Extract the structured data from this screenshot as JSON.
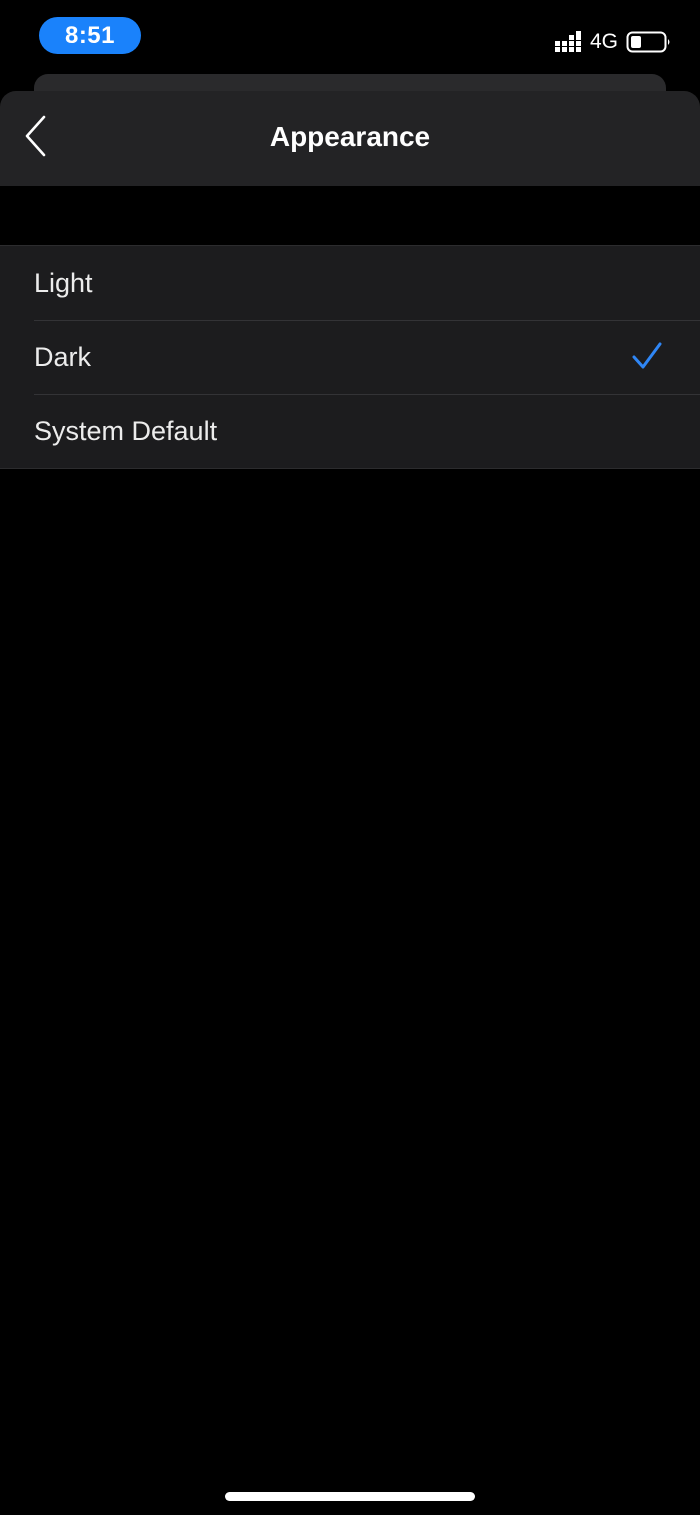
{
  "status_bar": {
    "time": "8:51",
    "network": "4G",
    "signal_icon": "signal-bars-icon",
    "battery_icon": "battery-icon",
    "time_pill_color": "#1a82fb"
  },
  "header": {
    "title": "Appearance",
    "back_icon": "chevron-left-icon"
  },
  "options": [
    {
      "label": "Light",
      "selected": false
    },
    {
      "label": "Dark",
      "selected": true
    },
    {
      "label": "System Default",
      "selected": false
    }
  ],
  "colors": {
    "accent": "#2f86f5",
    "background": "#000000",
    "row_background": "#1c1c1e",
    "header_background": "#232325"
  }
}
